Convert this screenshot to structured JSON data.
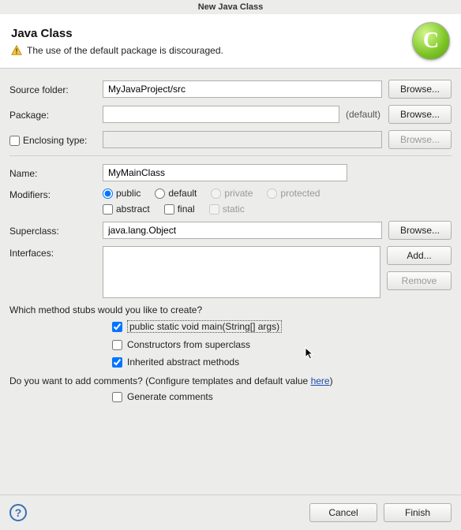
{
  "title_bar": "New Java Class",
  "header": {
    "title": "Java Class",
    "warning": "The use of the default package is discouraged.",
    "badge_letter": "C"
  },
  "labels": {
    "source_folder": "Source folder:",
    "package": "Package:",
    "enclosing_type": "Enclosing type:",
    "name": "Name:",
    "modifiers": "Modifiers:",
    "superclass": "Superclass:",
    "interfaces": "Interfaces:",
    "default_annot": "(default)"
  },
  "fields": {
    "source_folder": "MyJavaProject/src",
    "package": "",
    "enclosing_type": "",
    "name": "MyMainClass",
    "superclass": "java.lang.Object"
  },
  "buttons": {
    "browse": "Browse...",
    "add": "Add...",
    "remove": "Remove",
    "cancel": "Cancel",
    "finish": "Finish"
  },
  "modifiers": {
    "public": "public",
    "default": "default",
    "private": "private",
    "protected": "protected",
    "abstract": "abstract",
    "final": "final",
    "static": "static"
  },
  "stubs": {
    "question": "Which method stubs would you like to create?",
    "main_method": "public static void main(String[] args)",
    "constructors": "Constructors from superclass",
    "inherited": "Inherited abstract methods"
  },
  "comments": {
    "question_pre": "Do you want to add comments? (Configure templates and default value ",
    "here": "here",
    "question_post": ")",
    "generate": "Generate comments"
  }
}
